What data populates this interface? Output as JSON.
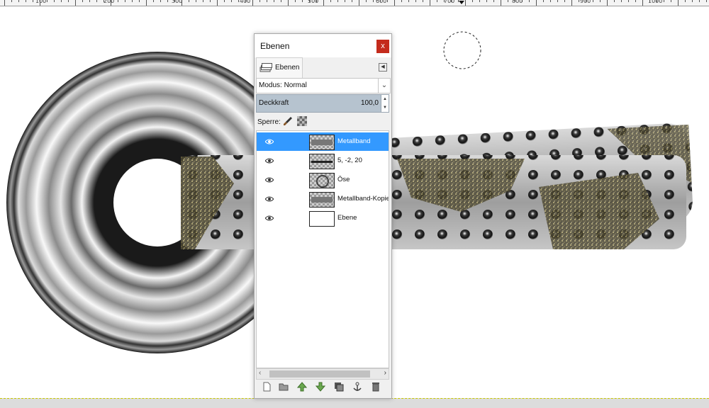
{
  "ruler": {
    "labels": [
      "100",
      "200",
      "300",
      "400",
      "500",
      "600",
      "700",
      "800",
      "900",
      "1000"
    ]
  },
  "dialog": {
    "title": "Ebenen",
    "close_label": "x",
    "tab_label": "Ebenen",
    "mode_label": "Modus: Normal",
    "opacity_label": "Deckkraft",
    "opacity_value": "100,0",
    "lock_label": "Sperre:"
  },
  "layers": [
    {
      "name": "Metallband",
      "visible": true,
      "selected": true
    },
    {
      "name": "5, -2, 20",
      "visible": true,
      "selected": false
    },
    {
      "name": "Öse",
      "visible": true,
      "selected": false
    },
    {
      "name": "Metallband-Kopie",
      "visible": true,
      "selected": false
    },
    {
      "name": "Ebene",
      "visible": true,
      "selected": false
    }
  ],
  "toolbar_icons": [
    "new-layer-icon",
    "new-group-icon",
    "raise-layer-icon",
    "lower-layer-icon",
    "duplicate-layer-icon",
    "anchor-layer-icon",
    "delete-layer-icon"
  ],
  "colors": {
    "selection": "#3399ff",
    "close_button": "#c42b1c",
    "opacity_bar": "#b6c3cf"
  }
}
